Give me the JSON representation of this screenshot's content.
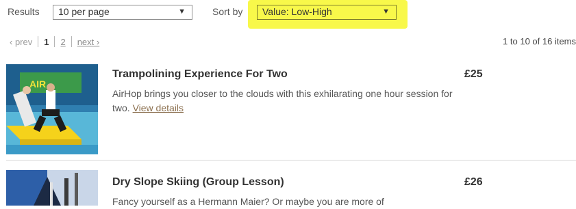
{
  "controls": {
    "results_label": "Results",
    "per_page_value": "10 per page",
    "sort_label": "Sort by",
    "sort_value": "Value: Low-High",
    "highlight_color": "#f8f84a"
  },
  "pagination": {
    "prev": "‹ prev",
    "pages": [
      "1",
      "2"
    ],
    "current_page": "1",
    "next": "next ›",
    "summary": "1 to 10 of 16 items"
  },
  "items": [
    {
      "title": "Trampolining Experience For Two",
      "price": "£25",
      "description": "AirHop brings you closer to the clouds with this exhilarating one hour session for two.",
      "view_link": "View details",
      "thumb_icon": "trampoline-photo"
    },
    {
      "title": "Dry Slope Skiing (Group Lesson)",
      "price": "£26",
      "description": "Fancy yourself as a Hermann Maier? Or maybe you are more of",
      "thumb_icon": "skiing-photo"
    }
  ]
}
